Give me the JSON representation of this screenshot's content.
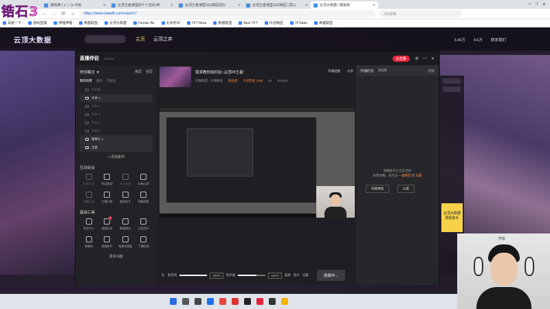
{
  "overlay": {
    "logo_text": "锆石3"
  },
  "browser": {
    "tabs": [
      {
        "label": "游戏神 ( ɔ ˘⌣˘)ɔ 平的",
        "active": false
      },
      {
        "label": "云顶王者课堂的个人空间-哔",
        "active": false
      },
      {
        "label": "云顶王者课堂S16神冠羽刃",
        "active": false
      },
      {
        "label": "云顶王者课堂S16神冠二周三",
        "active": false
      },
      {
        "label": "云顶大数据 | 概装表",
        "active": true
      }
    ],
    "address": "https://www.datatft.com/rate#17",
    "search_placeholder": "360搜索",
    "bookmarks": [
      "百度一下",
      "游戏直播",
      "押哩押哩",
      "英雄联盟",
      "云顶大数据",
      "Human Be",
      "北京时间",
      "TFT Meta",
      "英雄联盟",
      "Best TFT",
      "抖音精选",
      "TFTable",
      "英雄联盟"
    ]
  },
  "site": {
    "logo": "云顶大数据",
    "nav": [
      "主页",
      "云顶之弈"
    ],
    "nav_active": "主页",
    "right_items": [
      "3.06万",
      "4.6万",
      "联系我们"
    ],
    "bottom_stats": [
      "码率:0Kb/s",
      "FPS:60",
      "丢帧:0(0.00%)",
      "CPU:10%",
      "内存:38%",
      "未开播"
    ],
    "side_labels": [
      "意见反馈",
      "工具库"
    ],
    "ad_text": "云顶大数据 赞助助手"
  },
  "app": {
    "name": "直播伴侣",
    "version": "6.3.4.4",
    "live_pill": "云直播",
    "mode_label": "常规模式 ▼",
    "mode_actions": [
      "横屏",
      "竖屏"
    ],
    "scene_header": "我的场景",
    "scene_tabs": [
      "我的场景",
      "素材",
      "可视化"
    ],
    "sources": [
      {
        "name": "浏览器",
        "active": false
      },
      {
        "name": "文本 1",
        "active": true
      },
      {
        "name": "文本 1",
        "active": false
      },
      {
        "name": "文本 2",
        "active": false
      },
      {
        "name": "文本 4",
        "active": false
      },
      {
        "name": "文本 5",
        "active": false
      },
      {
        "name": "摄像头 1",
        "active": true
      },
      {
        "name": "全屏",
        "active": true
      }
    ],
    "add_source": "+ 添加素材",
    "interact": {
      "title": "互动玩法",
      "items": [
        {
          "label": "礼物互动",
          "dim": true
        },
        {
          "label": "幸运挑战",
          "dim": false
        },
        {
          "label": "开心农场",
          "dim": true
        },
        {
          "label": "礼物心愿",
          "dim": false
        },
        {
          "label": "弹幕玩法",
          "dim": true
        },
        {
          "label": "主播口袋",
          "dim": false
        },
        {
          "label": "抽奖助手",
          "dim": false
        },
        {
          "label": "弹幕投影",
          "dim": false
        }
      ]
    },
    "tools": {
      "title": "基础工具",
      "items": [
        {
          "label": "任务中心",
          "badge": ""
        },
        {
          "label": "直播任务",
          "badge": "1"
        },
        {
          "label": "数据概览",
          "badge": ""
        },
        {
          "label": "正版音乐",
          "badge": ""
        },
        {
          "label": "弹幕机",
          "badge": ""
        },
        {
          "label": "直播助手",
          "badge": ""
        },
        {
          "label": "场景切换器",
          "badge": ""
        },
        {
          "label": "下播检测",
          "badge": ""
        }
      ]
    },
    "more": "更多功能",
    "room": {
      "title": "我来教你如何玩~云顶冲王者!",
      "category": "英雄联盟 · 大神解说",
      "fans_club": "粉丝团",
      "rank": "今日百名 1190",
      "comments": "24",
      "likes": "971169",
      "tools": [
        "开播提醒",
        "分享"
      ]
    },
    "mixer": {
      "mic_label": "麦克风",
      "mic_pct": "150%",
      "speaker_label": "扬声器",
      "speaker_pct": "100%",
      "mic_level": 1.0,
      "speaker_level": 0.66,
      "actions": [
        "美颜",
        "变声",
        "设置"
      ],
      "go_live": "连接中..."
    },
    "right": {
      "tab": "开播时长",
      "count": "1/120",
      "detail": "详情",
      "msg_line1": "弹幕助手已全局消失",
      "msg_line2": "如需弹幕，请点击",
      "msg_link": "一键唤回",
      "msg_tail": "或",
      "msg_link2": "设置",
      "btn_hide": "隐藏横幅",
      "btn_set": "设置"
    }
  },
  "webcam": {
    "label": "奔客"
  }
}
